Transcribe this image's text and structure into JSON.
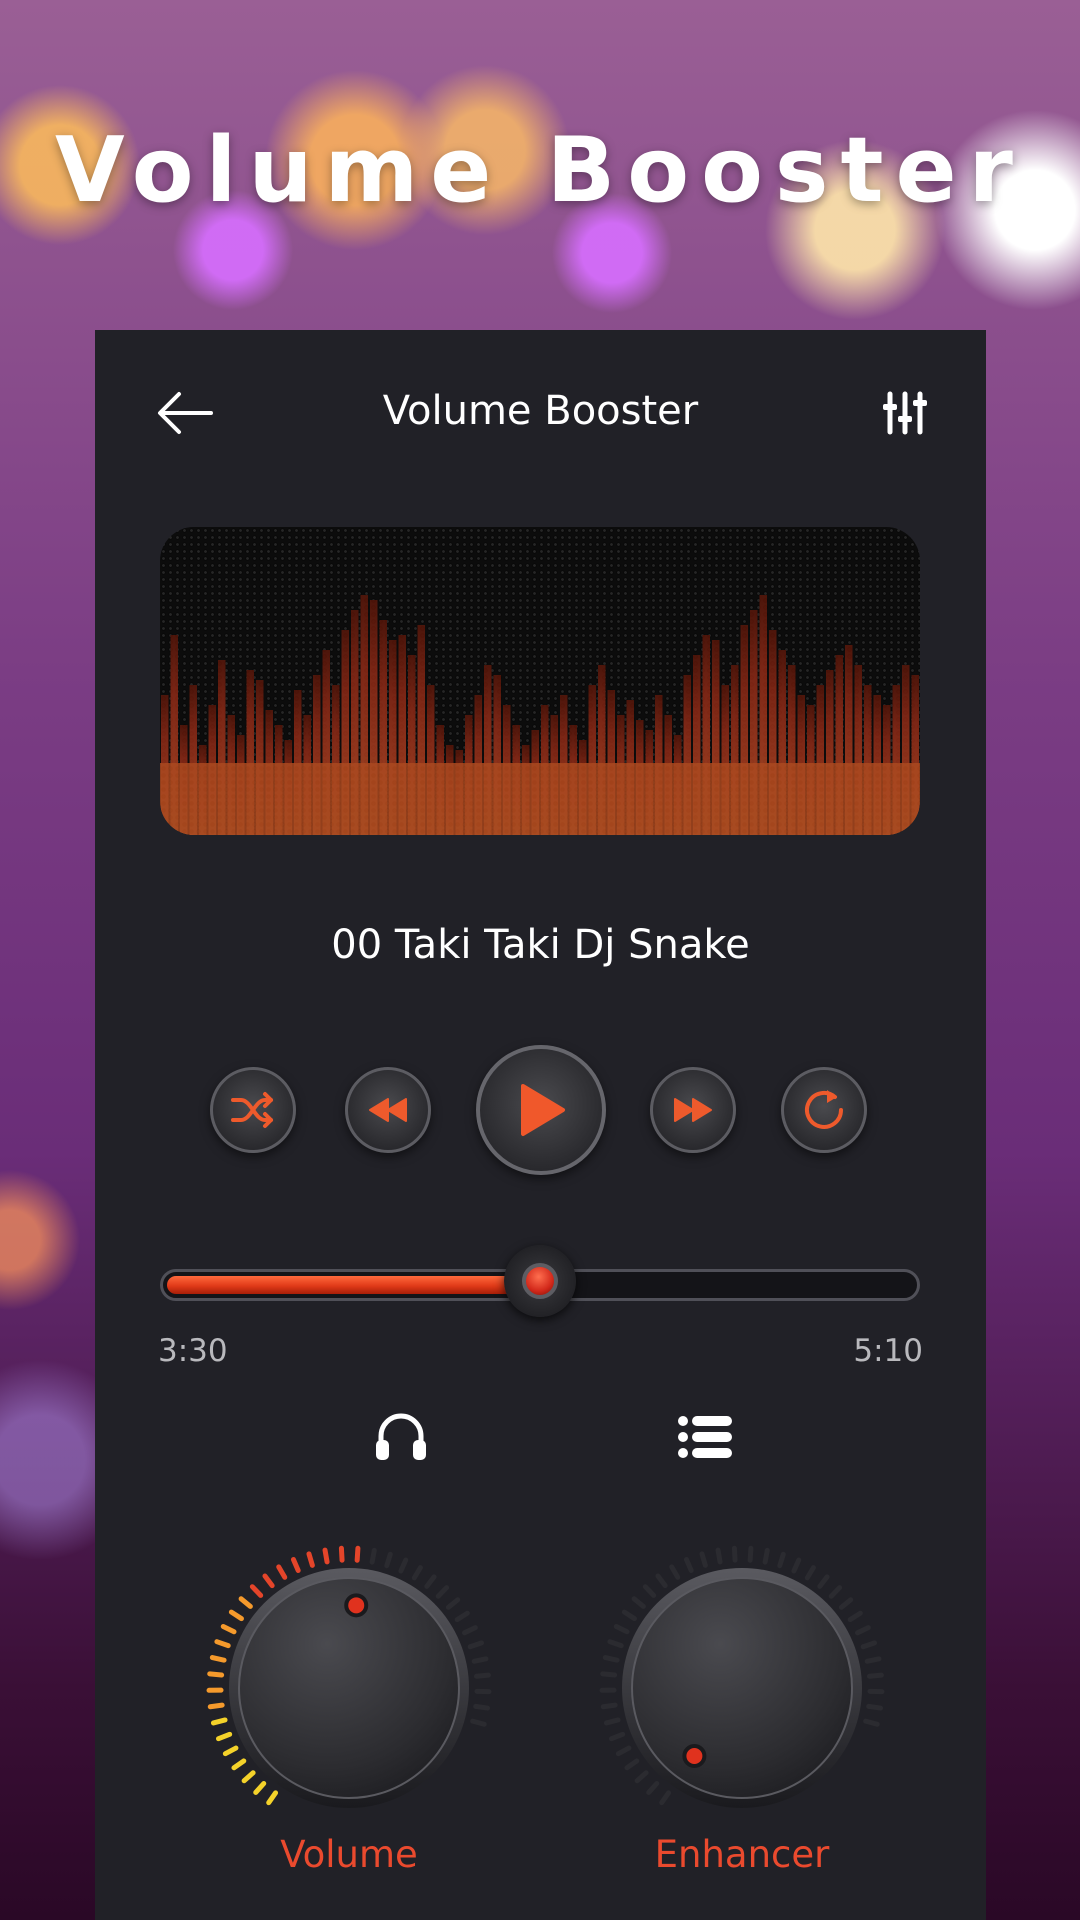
{
  "hero": {
    "title": "Volume Booster"
  },
  "app": {
    "title": "Volume Booster",
    "back_icon": "arrow-left-icon",
    "eq_icon": "equalizer-sliders-icon"
  },
  "player": {
    "song_title": "00 Taki Taki Dj Snake",
    "controls": [
      "shuffle-icon",
      "rewind-icon",
      "play-icon",
      "fast-forward-icon",
      "repeat-icon"
    ],
    "progress": 0.5,
    "time_elapsed": "3:30",
    "time_total": "5:10"
  },
  "actions": [
    "headphones-icon",
    "playlist-icon"
  ],
  "knobs": [
    {
      "label": "Volume",
      "level": 0.6
    },
    {
      "label": "Enhancer",
      "level": 0.0
    }
  ],
  "colors": {
    "accent": "#ea4a2e",
    "panel": "#212127",
    "viz_top": "#ff6a2a",
    "viz_bottom": "#ff8a3d"
  }
}
